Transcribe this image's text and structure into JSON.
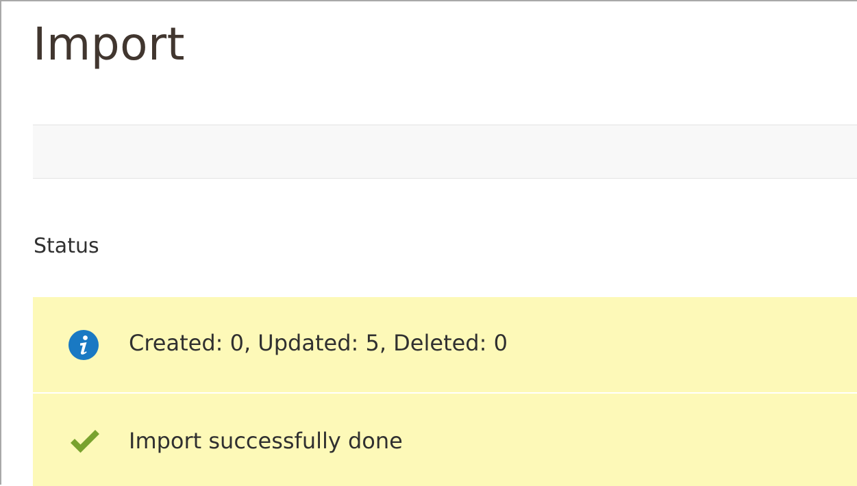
{
  "page": {
    "title": "Import"
  },
  "status_section": {
    "title": "Status"
  },
  "messages": [
    {
      "type": "info",
      "icon": "info-icon",
      "text": "Created: 0, Updated: 5, Deleted: 0"
    },
    {
      "type": "success",
      "icon": "checkmark-icon",
      "text": "Import successfully done"
    }
  ],
  "colors": {
    "title": "#41362f",
    "message_background": "#fdf9b8",
    "info_icon": "#1979c3",
    "success_icon": "#79a22e",
    "actions_bar_background": "#f8f8f8"
  }
}
